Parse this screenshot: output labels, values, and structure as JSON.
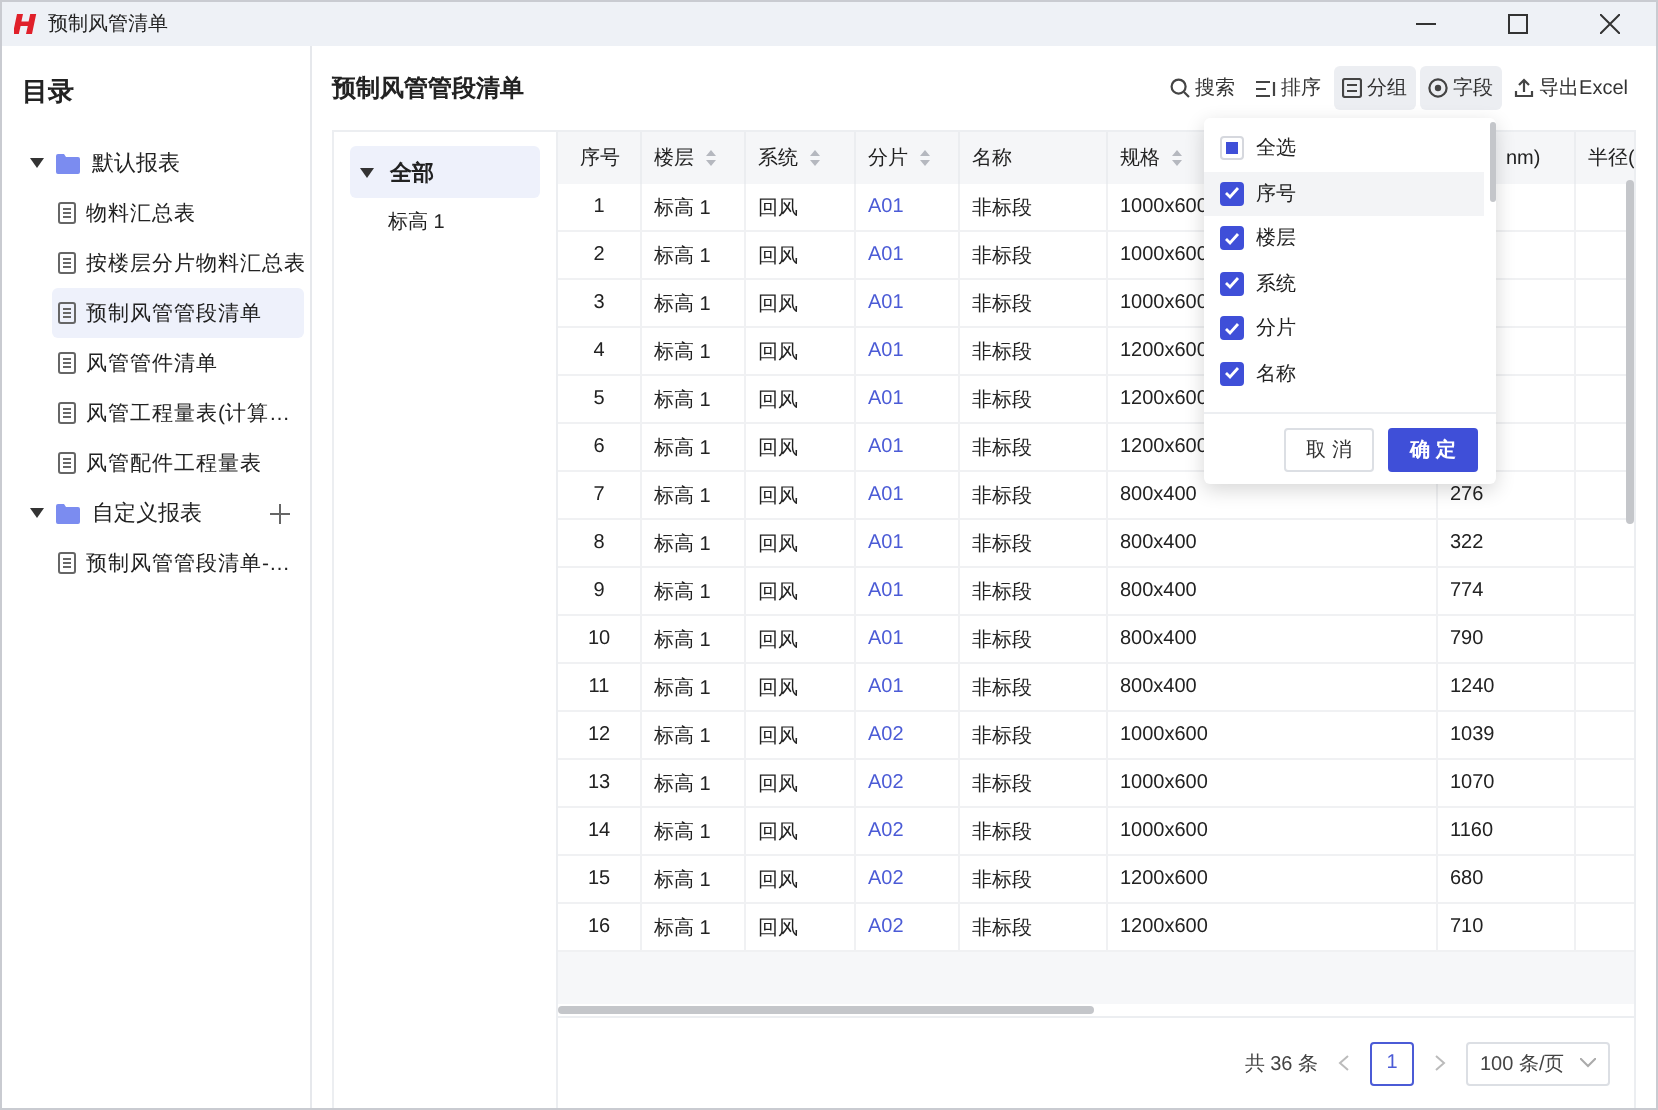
{
  "window": {
    "title": "预制风管清单"
  },
  "sidebar": {
    "title": "目录",
    "groups": [
      {
        "label": "默认报表",
        "expanded": true,
        "addable": false,
        "children": [
          {
            "label": "物料汇总表",
            "selected": false
          },
          {
            "label": "按楼层分片物料汇总表",
            "selected": false
          },
          {
            "label": "预制风管管段清单",
            "selected": true
          },
          {
            "label": "风管管件清单",
            "selected": false
          },
          {
            "label": "风管工程量表(计算…",
            "selected": false
          },
          {
            "label": "风管配件工程量表",
            "selected": false
          }
        ]
      },
      {
        "label": "自定义报表",
        "expanded": true,
        "addable": true,
        "children": [
          {
            "label": "预制风管管段清单-…",
            "selected": false
          }
        ]
      }
    ]
  },
  "main": {
    "title": "预制风管管段清单",
    "toolbar": [
      {
        "label": "搜索",
        "kind": "search",
        "active": false
      },
      {
        "label": "排序",
        "kind": "sort",
        "active": false
      },
      {
        "label": "分组",
        "kind": "group",
        "active": true
      },
      {
        "label": "字段",
        "kind": "field",
        "active": true
      },
      {
        "label": "导出Excel",
        "kind": "export",
        "active": false
      }
    ],
    "tree": [
      {
        "label": "全部",
        "expanded": true,
        "selected": true,
        "children": [
          {
            "label": "标高 1",
            "selected": false
          }
        ]
      }
    ],
    "table": {
      "columns": [
        {
          "label": "序号",
          "sortable": false,
          "kind": "index"
        },
        {
          "label": "楼层",
          "sortable": true,
          "kind": "text"
        },
        {
          "label": "系统",
          "sortable": true,
          "kind": "text"
        },
        {
          "label": "分片",
          "sortable": true,
          "kind": "link"
        },
        {
          "label": "名称",
          "sortable": false,
          "kind": "text"
        },
        {
          "label": "规格",
          "sortable": true,
          "kind": "wide"
        },
        {
          "label": "nm)",
          "sortable": false,
          "kind": "partial"
        },
        {
          "label": "半径(",
          "kind": "edge"
        }
      ],
      "rows": [
        [
          "1",
          "标高 1",
          "回风",
          "A01",
          "非标段",
          "1000x600",
          null
        ],
        [
          "2",
          "标高 1",
          "回风",
          "A01",
          "非标段",
          "1000x600",
          null
        ],
        [
          "3",
          "标高 1",
          "回风",
          "A01",
          "非标段",
          "1000x600",
          null
        ],
        [
          "4",
          "标高 1",
          "回风",
          "A01",
          "非标段",
          "1200x600",
          null
        ],
        [
          "5",
          "标高 1",
          "回风",
          "A01",
          "非标段",
          "1200x600",
          null
        ],
        [
          "6",
          "标高 1",
          "回风",
          "A01",
          "非标段",
          "1200x600",
          null
        ],
        [
          "7",
          "标高 1",
          "回风",
          "A01",
          "非标段",
          "800x400",
          "276"
        ],
        [
          "8",
          "标高 1",
          "回风",
          "A01",
          "非标段",
          "800x400",
          "322"
        ],
        [
          "9",
          "标高 1",
          "回风",
          "A01",
          "非标段",
          "800x400",
          "774"
        ],
        [
          "10",
          "标高 1",
          "回风",
          "A01",
          "非标段",
          "800x400",
          "790"
        ],
        [
          "11",
          "标高 1",
          "回风",
          "A01",
          "非标段",
          "800x400",
          "1240"
        ],
        [
          "12",
          "标高 1",
          "回风",
          "A02",
          "非标段",
          "1000x600",
          "1039"
        ],
        [
          "13",
          "标高 1",
          "回风",
          "A02",
          "非标段",
          "1000x600",
          "1070"
        ],
        [
          "14",
          "标高 1",
          "回风",
          "A02",
          "非标段",
          "1000x600",
          "1160"
        ],
        [
          "15",
          "标高 1",
          "回风",
          "A02",
          "非标段",
          "1200x600",
          "680"
        ],
        [
          "16",
          "标高 1",
          "回风",
          "A02",
          "非标段",
          "1200x600",
          "710"
        ]
      ]
    },
    "pagination": {
      "total": "共 36 条",
      "pages": [
        {
          "label": "1",
          "selected": true
        }
      ],
      "page_size": "100 条/页"
    },
    "field_popover": {
      "items": [
        {
          "label": "全选",
          "checked": false,
          "indeterminate": true,
          "highlighted": false
        },
        {
          "label": "序号",
          "checked": true,
          "highlighted": true
        },
        {
          "label": "楼层",
          "checked": true,
          "highlighted": false
        },
        {
          "label": "系统",
          "checked": true,
          "highlighted": false
        },
        {
          "label": "分片",
          "checked": true,
          "highlighted": false
        },
        {
          "label": "名称",
          "checked": true,
          "highlighted": false
        }
      ],
      "cancel": "取 消",
      "confirm": "确 定"
    }
  }
}
